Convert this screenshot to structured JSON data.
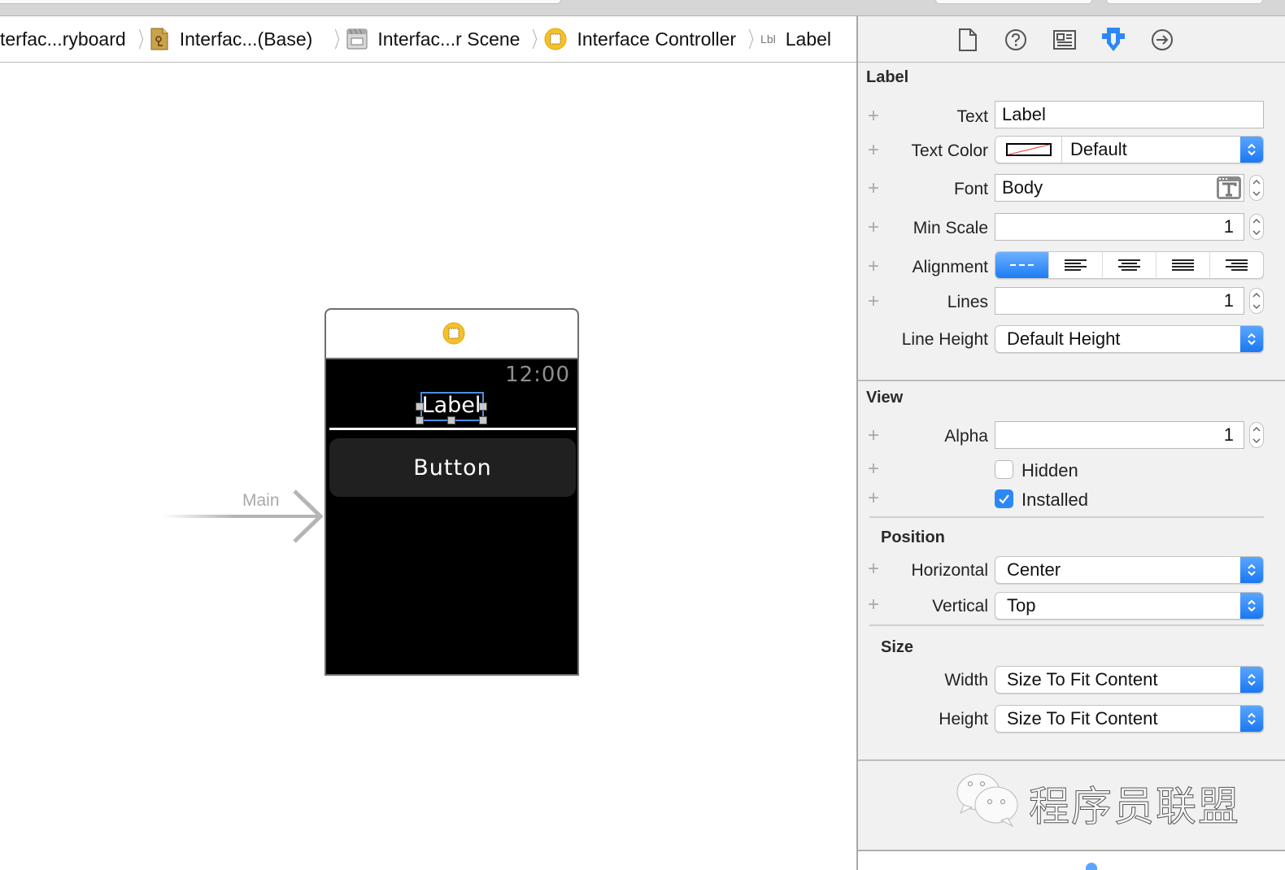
{
  "jumpbar": {
    "crumbs": [
      {
        "label": "terfac...ryboard",
        "icon": "storyboard-icon"
      },
      {
        "label": "Interfac...(Base)",
        "icon": "localized-storyboard-icon"
      },
      {
        "label": "Interfac...r Scene",
        "icon": "scene-icon"
      },
      {
        "label": "Interface Controller",
        "icon": "interface-controller-icon"
      },
      {
        "label": "Label",
        "tag": "Lbl",
        "icon": "label-icon"
      }
    ]
  },
  "canvas": {
    "entry_point_label": "Main",
    "watch": {
      "time": "12:00",
      "label_text": "Label",
      "button_text": "Button"
    }
  },
  "inspector": {
    "tabs": [
      {
        "name": "file-inspector",
        "icon": "file-icon",
        "active": false
      },
      {
        "name": "quick-help",
        "icon": "help-icon",
        "active": false
      },
      {
        "name": "identity-inspector",
        "icon": "identity-icon",
        "active": false
      },
      {
        "name": "attributes-inspector",
        "icon": "attributes-icon",
        "active": true
      },
      {
        "name": "connections-inspector",
        "icon": "arrow-right-circle-icon",
        "active": false
      }
    ],
    "label_section": {
      "title": "Label",
      "text_label": "Text",
      "text_value": "Label",
      "text_color_label": "Text Color",
      "text_color_value": "Default",
      "font_label": "Font",
      "font_value": "Body",
      "min_scale_label": "Min Scale",
      "min_scale_value": "1",
      "alignment_label": "Alignment",
      "alignment_options": [
        "natural",
        "left",
        "center",
        "justified",
        "right"
      ],
      "alignment_selected": "natural",
      "lines_label": "Lines",
      "lines_value": "1",
      "line_height_label": "Line Height",
      "line_height_value": "Default Height"
    },
    "view_section": {
      "title": "View",
      "alpha_label": "Alpha",
      "alpha_value": "1",
      "hidden_label": "Hidden",
      "hidden_checked": false,
      "installed_label": "Installed",
      "installed_checked": true,
      "position_title": "Position",
      "horizontal_label": "Horizontal",
      "horizontal_value": "Center",
      "vertical_label": "Vertical",
      "vertical_value": "Top",
      "size_title": "Size",
      "width_label": "Width",
      "width_value": "Size To Fit Content",
      "height_label": "Height",
      "height_value": "Size To Fit Content"
    },
    "watermark_text": "程序员联盟"
  },
  "colors": {
    "accent": "#1a78f2",
    "watch_bg": "#000000",
    "watch_button": "#202020",
    "controller_icon": "#f5c02a",
    "selection": "#4a90e2"
  }
}
